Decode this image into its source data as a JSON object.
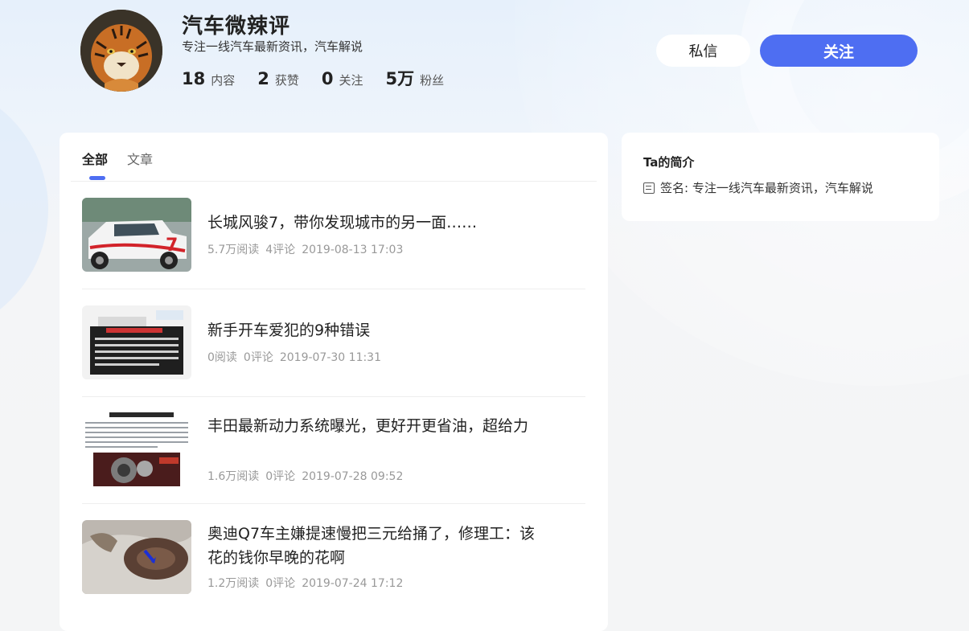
{
  "profile": {
    "name": "汽车微辣评",
    "description": "专注一线汽车最新资讯，汽车解说",
    "stats": [
      {
        "num": "18",
        "label": "内容"
      },
      {
        "num": "2",
        "label": "获赞"
      },
      {
        "num": "0",
        "label": "关注"
      },
      {
        "num": "5万",
        "label": "粉丝"
      }
    ],
    "message_button": "私信",
    "follow_button": "关注"
  },
  "tabs": [
    {
      "label": "全部",
      "active": true
    },
    {
      "label": "文章",
      "active": false
    }
  ],
  "articles": [
    {
      "title": "长城风骏7，带你发现城市的另一面……",
      "reads": "5.7万阅读",
      "comments": "4评论",
      "time": "2019-08-13 17:03"
    },
    {
      "title": "新手开车爱犯的9种错误",
      "reads": "0阅读",
      "comments": "0评论",
      "time": "2019-07-30 11:31"
    },
    {
      "title": "丰田最新动力系统曝光，更好开更省油，超给力",
      "reads": "1.6万阅读",
      "comments": "0评论",
      "time": "2019-07-28 09:52"
    },
    {
      "title": "奥迪Q7车主嫌提速慢把三元给捅了，修理工：该花的钱你早晚的花啊",
      "reads": "1.2万阅读",
      "comments": "0评论",
      "time": "2019-07-24 17:12"
    }
  ],
  "sidebar": {
    "title": "Ta的简介",
    "sign_label": "签名: 专注一线汽车最新资讯，汽车解说",
    "sign_icon": "document-icon"
  },
  "colors": {
    "accent": "#4e6ef2"
  }
}
